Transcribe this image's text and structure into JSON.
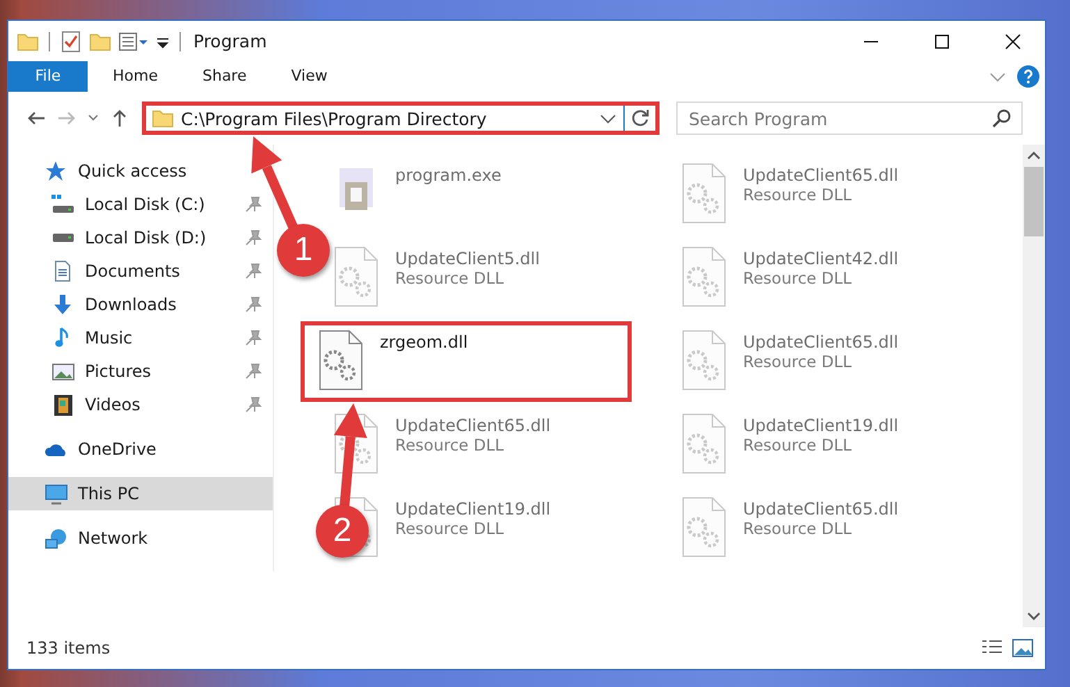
{
  "window": {
    "title": "Program"
  },
  "ribbon_tabs": [
    {
      "label": "File",
      "selected": true
    },
    {
      "label": "Home",
      "selected": false
    },
    {
      "label": "Share",
      "selected": false
    },
    {
      "label": "View",
      "selected": false
    }
  ],
  "address_bar": {
    "path": "C:\\Program Files\\Program Directory",
    "highlighted": true
  },
  "search": {
    "placeholder": "Search Program"
  },
  "sidebar": {
    "items": [
      {
        "label": "Quick access",
        "kind": "star",
        "selected": false,
        "children": [
          {
            "label": "Local Disk (C:)",
            "kind": "windisk",
            "pinned": true,
            "selected": false
          },
          {
            "label": "Local Disk (D:)",
            "kind": "disk",
            "pinned": true,
            "selected": false
          },
          {
            "label": "Documents",
            "kind": "doc",
            "pinned": true,
            "selected": false
          },
          {
            "label": "Downloads",
            "kind": "download",
            "pinned": true,
            "selected": false
          },
          {
            "label": "Music",
            "kind": "music",
            "pinned": true,
            "selected": false
          },
          {
            "label": "Pictures",
            "kind": "picture",
            "pinned": true,
            "selected": false
          },
          {
            "label": "Videos",
            "kind": "video",
            "pinned": true,
            "selected": false
          }
        ]
      },
      {
        "label": "OneDrive",
        "kind": "cloud",
        "selected": false
      },
      {
        "label": "This PC",
        "kind": "pc",
        "selected": true
      },
      {
        "label": "Network",
        "kind": "network",
        "selected": false
      }
    ]
  },
  "files": [
    {
      "name": "program.exe",
      "kind": "exe",
      "blurred": true,
      "highlighted": false
    },
    {
      "name": "UpdateClient65.dll",
      "type": "Resource DLL",
      "kind": "dll",
      "blurred": true,
      "highlighted": false
    },
    {
      "name": "UpdateClient5.dll",
      "type": "Resource DLL",
      "kind": "dll",
      "blurred": true,
      "highlighted": false
    },
    {
      "name": "UpdateClient42.dll",
      "type": "Resource DLL",
      "kind": "dll",
      "blurred": true,
      "highlighted": false
    },
    {
      "name": "zrgeom.dll",
      "kind": "dll",
      "blurred": false,
      "highlighted": true
    },
    {
      "name": "UpdateClient65.dll",
      "type": "Resource DLL",
      "kind": "dll",
      "blurred": true,
      "highlighted": false
    },
    {
      "name": "UpdateClient65.dll",
      "type": "Resource DLL",
      "kind": "dll",
      "blurred": true,
      "highlighted": false
    },
    {
      "name": "UpdateClient19.dll",
      "type": "Resource DLL",
      "kind": "dll",
      "blurred": true,
      "highlighted": false
    },
    {
      "name": "UpdateClient19.dll",
      "type": "Resource DLL",
      "kind": "dll",
      "blurred": true,
      "highlighted": false
    },
    {
      "name": "UpdateClient65.dll",
      "type": "Resource DLL",
      "kind": "dll",
      "blurred": true,
      "highlighted": false
    }
  ],
  "callouts": [
    {
      "number": "1"
    },
    {
      "number": "2"
    }
  ],
  "status_bar": {
    "count": "133 items"
  }
}
